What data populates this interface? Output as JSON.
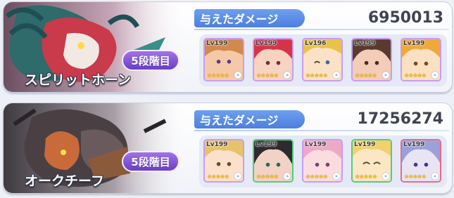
{
  "battles": [
    {
      "boss_name": "スピリットホーン",
      "stage": "5段階目",
      "damage_label": "与えたダメージ",
      "damage": "6950013",
      "units": [
        {
          "level": "Lv199",
          "stars": "★★★★★",
          "frame": "purple"
        },
        {
          "level": "Lv199",
          "stars": "★★★★★",
          "frame": "purple"
        },
        {
          "level": "Lv196",
          "stars": "★★★★★",
          "frame": "purple"
        },
        {
          "level": "Lv199",
          "stars": "★★★★★",
          "frame": "purple"
        },
        {
          "level": "Lv199",
          "stars": "★★★★★",
          "frame": "purple"
        }
      ]
    },
    {
      "boss_name": "オークチーフ",
      "stage": "5段階目",
      "damage_label": "与えたダメージ",
      "damage": "17256274",
      "units": [
        {
          "level": "Lv199",
          "stars": "★★★★★",
          "frame": "purple"
        },
        {
          "level": "Lv199",
          "stars": "★★★★★",
          "frame": "green"
        },
        {
          "level": "Lv199",
          "stars": "★★★★★",
          "frame": "purple"
        },
        {
          "level": "Lv199",
          "stars": "★★★★★",
          "frame": "green"
        },
        {
          "level": "Lv199",
          "stars": "★★★★★",
          "frame": "pink"
        }
      ]
    }
  ],
  "colors": {
    "accent_blue": "#5b8ce6",
    "badge_purple": "#7b4fd6",
    "frame_purple": "#c99cf0",
    "frame_green": "#4fcf7a",
    "frame_pink": "#e86a8e"
  }
}
